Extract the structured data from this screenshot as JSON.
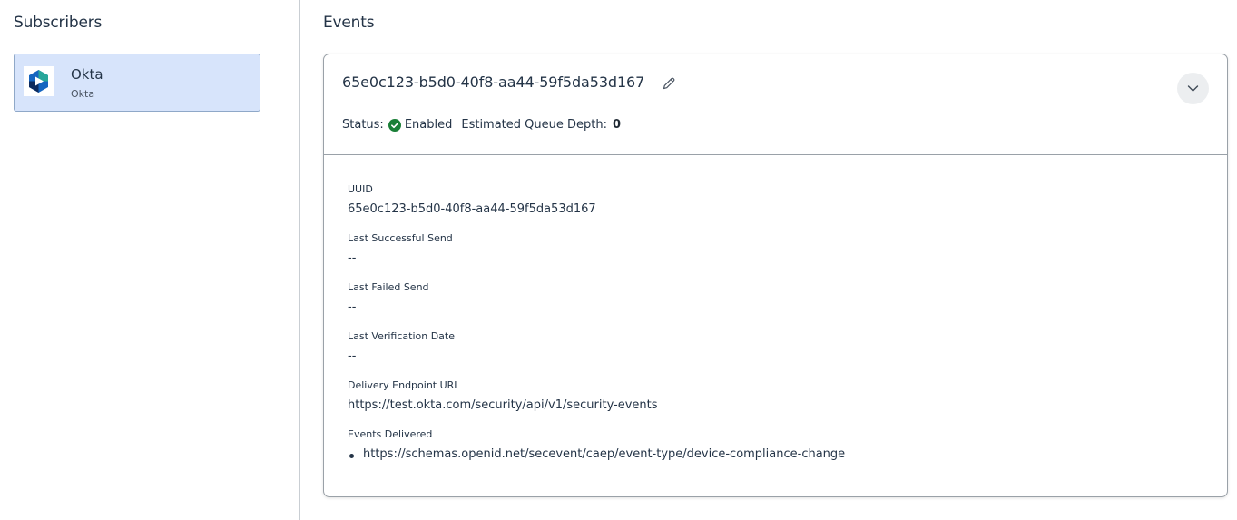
{
  "subscribers": {
    "title": "Subscribers",
    "items": [
      {
        "name": "Okta",
        "subtitle": "Okta",
        "icon": "okta-logo-icon"
      }
    ]
  },
  "events": {
    "title": "Events",
    "card": {
      "id": "65e0c123-b5d0-40f8-aa44-59f5da53d167",
      "status_label": "Status:",
      "status_value": "Enabled",
      "queue_label": "Estimated Queue Depth:",
      "queue_value": "0",
      "details": {
        "uuid_label": "UUID",
        "uuid_value": "65e0c123-b5d0-40f8-aa44-59f5da53d167",
        "last_successful_send_label": "Last Successful Send",
        "last_successful_send_value": "--",
        "last_failed_send_label": "Last Failed Send",
        "last_failed_send_value": "--",
        "last_verification_date_label": "Last Verification Date",
        "last_verification_date_value": "--",
        "delivery_endpoint_label": "Delivery Endpoint URL",
        "delivery_endpoint_value": "https://test.okta.com/security/api/v1/security-events",
        "events_delivered_label": "Events Delivered",
        "events_delivered": [
          "https://schemas.openid.net/secevent/caep/event-type/device-compliance-change"
        ]
      }
    }
  },
  "colors": {
    "selected_bg": "#d7e4fb",
    "status_green": "#1a7f37",
    "text": "#243447"
  },
  "icons": [
    "okta-logo-icon",
    "edit-pencil-icon",
    "check-circle-icon",
    "chevron-down-icon"
  ]
}
